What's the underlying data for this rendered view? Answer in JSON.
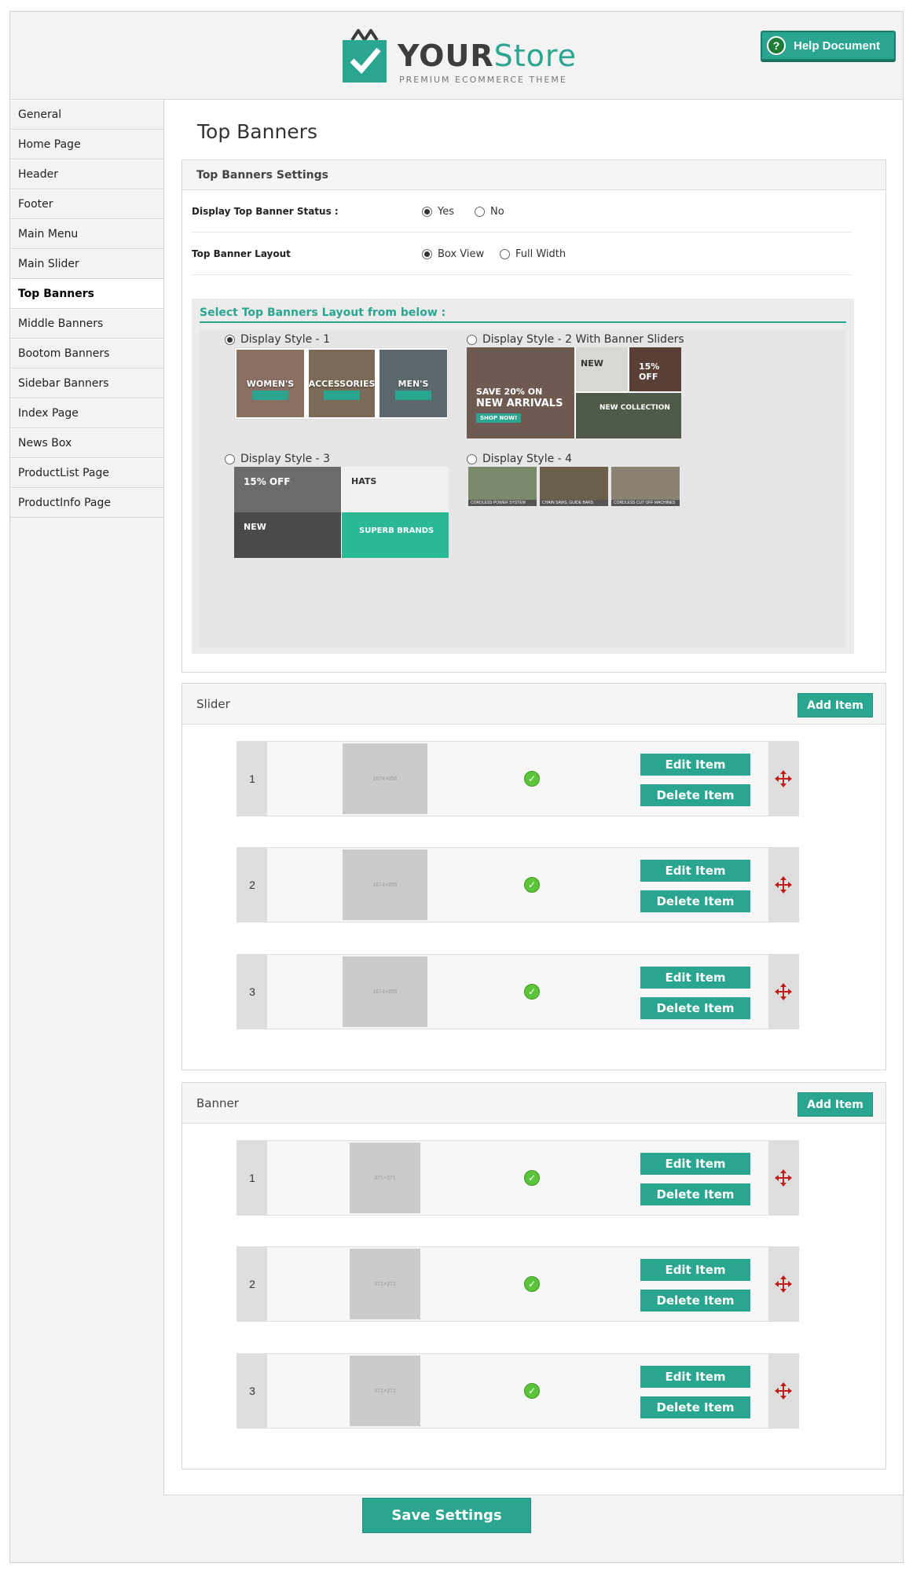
{
  "header": {
    "logo_your": "YOUR",
    "logo_store": "Store",
    "logo_tagline": "PREMIUM ECOMMERCE THEME",
    "help_label": "Help Document",
    "accent_color": "#2aa58f"
  },
  "sidebar": {
    "items": [
      {
        "label": "General"
      },
      {
        "label": "Home Page"
      },
      {
        "label": "Header"
      },
      {
        "label": "Footer"
      },
      {
        "label": "Main Menu"
      },
      {
        "label": "Main Slider"
      },
      {
        "label": "Top Banners",
        "active": true
      },
      {
        "label": "Middle Banners"
      },
      {
        "label": "Bootom Banners"
      },
      {
        "label": "Sidebar Banners"
      },
      {
        "label": "Index Page"
      },
      {
        "label": "News Box"
      },
      {
        "label": "ProductList Page"
      },
      {
        "label": "ProductInfo Page"
      }
    ]
  },
  "main": {
    "title": "Top Banners",
    "settings": {
      "heading": "Top Banners Settings",
      "status_label": "Display Top Banner Status :",
      "status_yes": "Yes",
      "status_no": "No",
      "status_value": "Yes",
      "layout_label": "Top Banner Layout",
      "layout_box": "Box View",
      "layout_full": "Full Width",
      "layout_value": "Box View",
      "select_title": "Select Top Banners Layout from below :",
      "styles": [
        {
          "label": "Display Style - 1",
          "selected": true
        },
        {
          "label": "Display Style - 2 With Banner Sliders",
          "selected": false
        },
        {
          "label": "Display Style - 3",
          "selected": false
        },
        {
          "label": "Display Style - 4",
          "selected": false
        }
      ],
      "style1_tiles": [
        "WOMEN'S",
        "ACCESSORIES",
        "MEN'S"
      ],
      "style2_texts": {
        "save": "SAVE 20% ON",
        "arrivals": "NEW ARRIVALS",
        "shop": "SHOP NOW!",
        "new": "NEW",
        "off": "15% OFF",
        "collection": "NEW COLLECTION"
      },
      "style3_texts": {
        "off": "15% OFF",
        "hats": "HATS",
        "new": "NEW",
        "brands": "SUPERB BRANDS"
      },
      "style4_captions": [
        "CORDLESS POWER SYSTEM",
        "CHAIN SAWS, GUIDE BARS",
        "CORDLESS CUT OFF MACHINES"
      ]
    },
    "slider": {
      "heading": "Slider",
      "add_label": "Add Item",
      "rows": [
        {
          "num": "1",
          "img": "1674×855",
          "edit": "Edit Item",
          "delete": "Delete Item"
        },
        {
          "num": "2",
          "img": "1674×855",
          "edit": "Edit Item",
          "delete": "Delete Item"
        },
        {
          "num": "3",
          "img": "1674×855",
          "edit": "Edit Item",
          "delete": "Delete Item"
        }
      ]
    },
    "banner": {
      "heading": "Banner",
      "add_label": "Add Item",
      "rows": [
        {
          "num": "1",
          "img": "371×371",
          "edit": "Edit Item",
          "delete": "Delete Item"
        },
        {
          "num": "2",
          "img": "371×371",
          "edit": "Edit Item",
          "delete": "Delete Item"
        },
        {
          "num": "3",
          "img": "371×371",
          "edit": "Edit Item",
          "delete": "Delete Item"
        }
      ]
    },
    "save_label": "Save Settings"
  }
}
